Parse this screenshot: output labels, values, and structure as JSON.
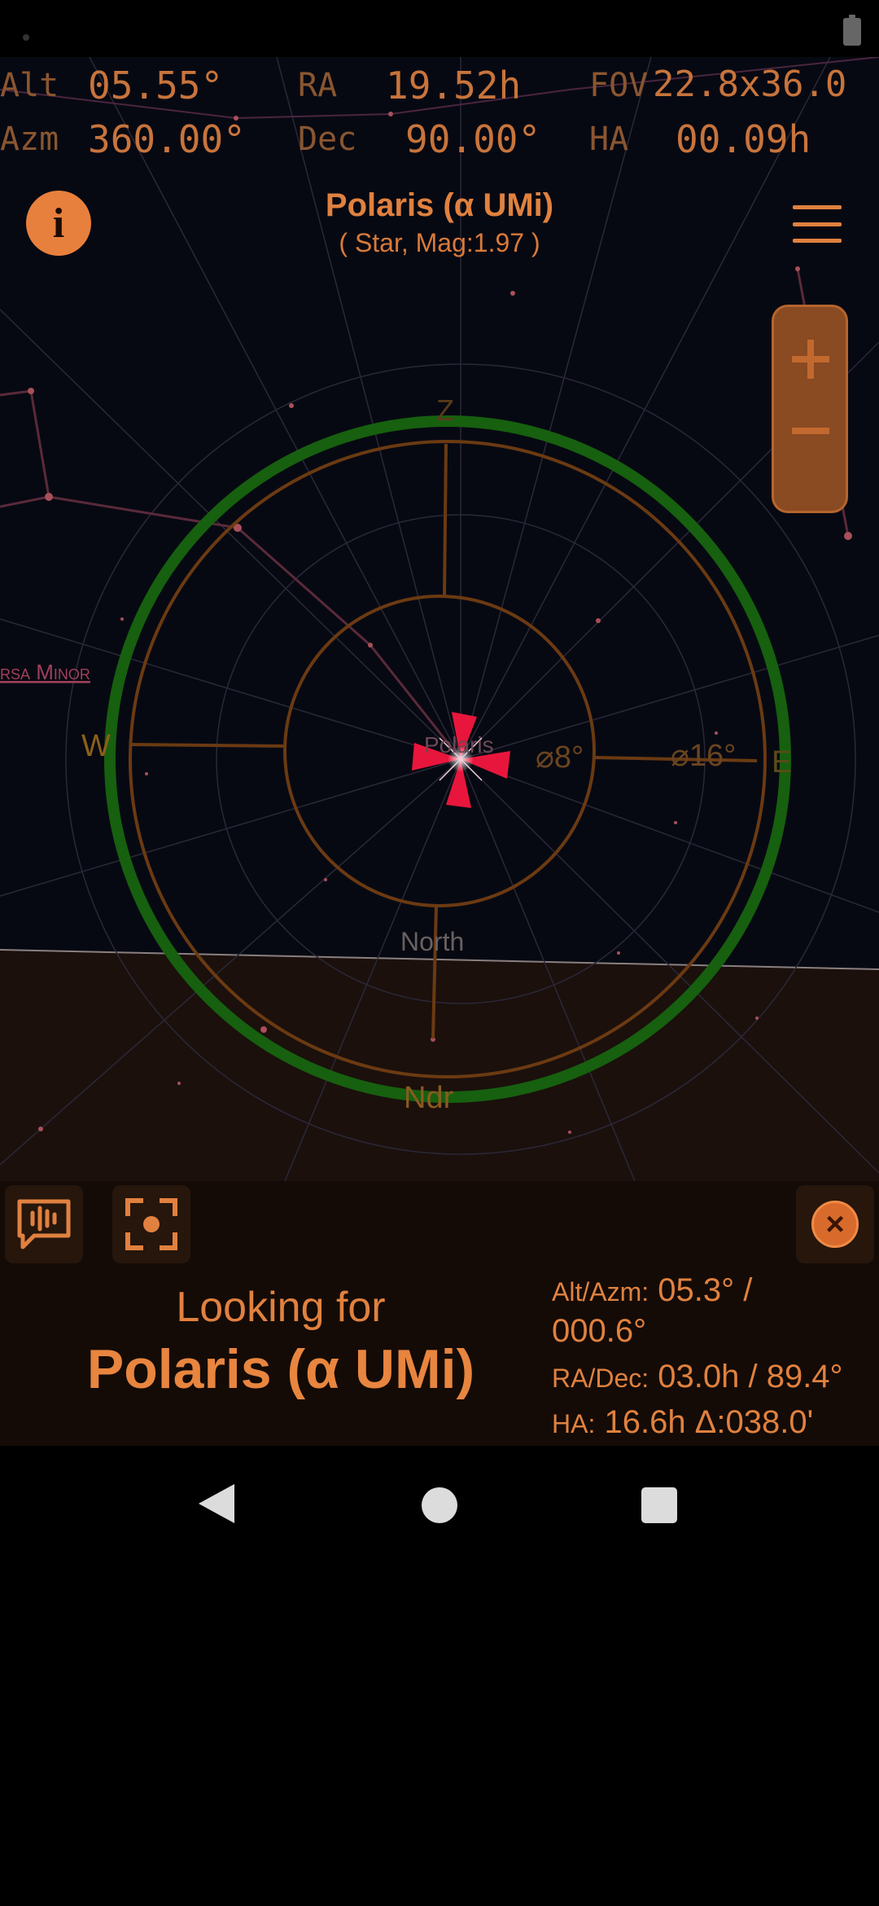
{
  "readouts": {
    "alt_label": "Alt",
    "alt_value": "05.55°",
    "ra_label": "RA",
    "ra_value": "19.52h",
    "fov_label": "FOV",
    "fov_value": "22.8x36.0",
    "azm_label": "Azm",
    "azm_value": "360.00°",
    "dec_label": "Dec",
    "dec_value": "90.00°",
    "ha_label": "HA",
    "ha_value": "00.09h"
  },
  "target": {
    "name": "Polaris (α UMi)",
    "details": "( Star, Mag:1.97 )"
  },
  "sky": {
    "constellation": "rsa Minor",
    "star_label": "Polaris",
    "zenith": "Z",
    "nadir": "Ndr",
    "west": "W",
    "east": "E",
    "north": "North",
    "inner_ring": "⌀8°",
    "outer_ring": "⌀16°"
  },
  "panel": {
    "looking_for": "Looking for",
    "target": "Polaris (α UMi)",
    "altazm_label": "Alt/Azm:",
    "altazm_value": "05.3° /",
    "altazm_value2": "000.6°",
    "radec_label": "RA/Dec:",
    "radec_value": "03.0h / 89.4°",
    "ha_label": "HA:",
    "ha_value": "16.6h Δ:038.0'"
  },
  "icons": {
    "info": "i",
    "close": "×",
    "voice": "voice-feedback-icon",
    "center": "center-focus-icon"
  },
  "colors": {
    "accent": "#e0813f",
    "ring_green": "#16600f",
    "ring_orange": "#6b3a12",
    "crosshair_red": "#e8163c"
  }
}
